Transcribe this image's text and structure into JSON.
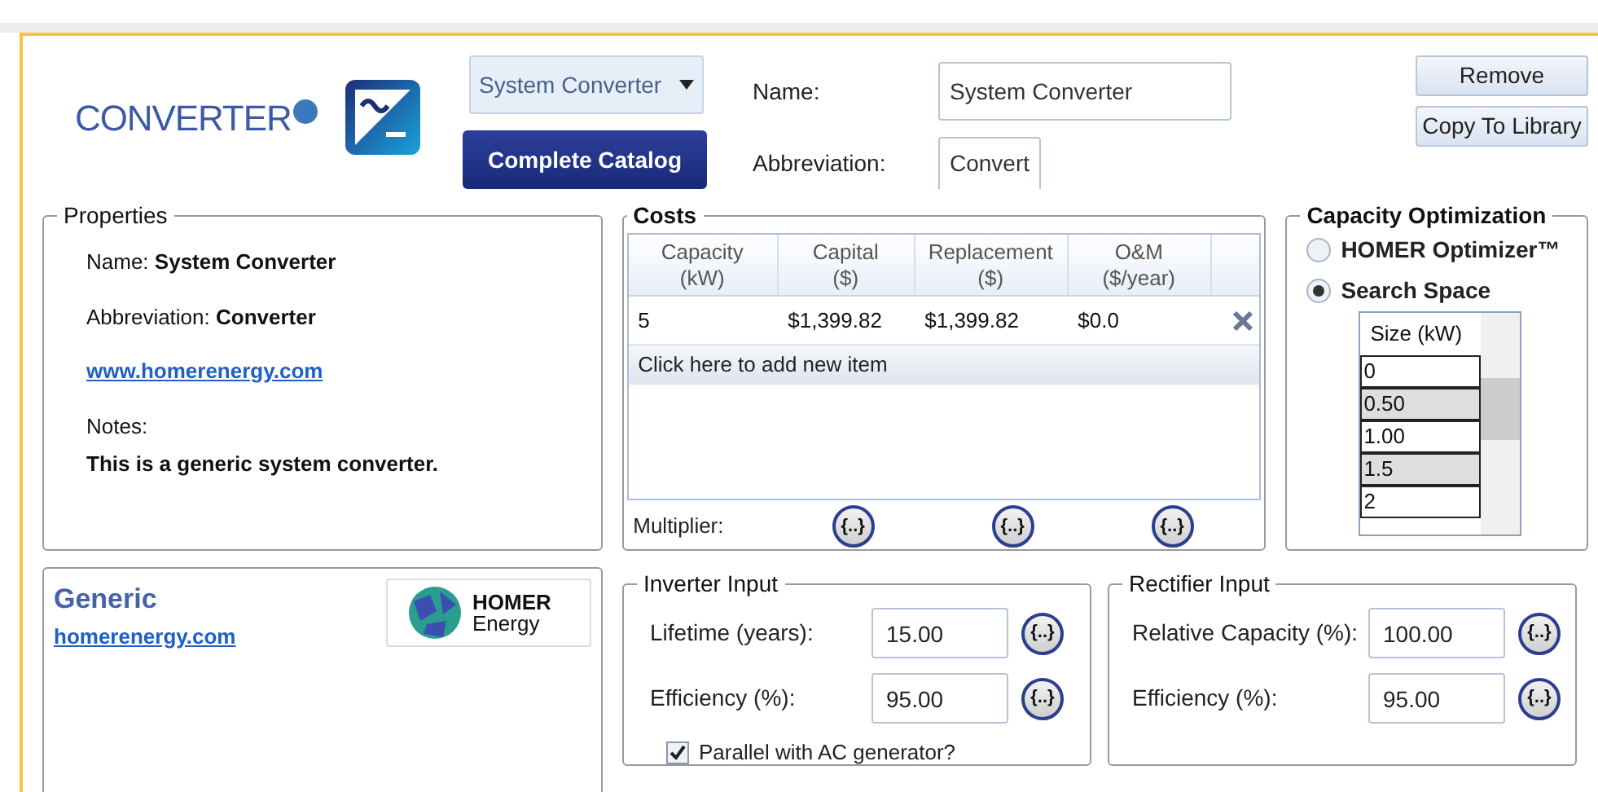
{
  "header": {
    "title": "CONVERTER",
    "type_dropdown": "System Converter",
    "catalog_button": "Complete Catalog",
    "name_label": "Name:",
    "name_value": "System Converter",
    "abbreviation_label": "Abbreviation:",
    "abbreviation_value": "Convert",
    "remove_button": "Remove",
    "copy_button": "Copy To Library"
  },
  "properties": {
    "title": "Properties",
    "name_label": "Name:",
    "name_value": "System Converter",
    "abbreviation_label": "Abbreviation:",
    "abbreviation_value": "Converter",
    "link": "www.homerenergy.com",
    "notes_label": "Notes:",
    "notes_value": "This is a generic system converter."
  },
  "costs": {
    "title": "Costs",
    "columns": [
      {
        "line1": "Capacity",
        "line2": "(kW)"
      },
      {
        "line1": "Capital",
        "line2": "($)"
      },
      {
        "line1": "Replacement",
        "line2": "($)"
      },
      {
        "line1": "O&M",
        "line2": "($/year)"
      }
    ],
    "rows": [
      {
        "cells": [
          "5",
          "$1,399.82",
          "$1,399.82",
          "$0.0"
        ]
      }
    ],
    "add_row": "Click here to add new item",
    "multiplier_label": "Multiplier:",
    "multiplier_buttons": [
      "{..}",
      "{..}",
      "{..}"
    ]
  },
  "capacity_optimization": {
    "title": "Capacity Optimization",
    "options": [
      {
        "label": "HOMER Optimizer™",
        "selected": false
      },
      {
        "label": "Search Space",
        "selected": true
      }
    ],
    "size_header": "Size (kW)",
    "sizes": [
      "0",
      "0.50",
      "1.00",
      "1.5",
      "2"
    ]
  },
  "manufacturer": {
    "name": "Generic",
    "link": "homerenergy.com",
    "logo_line1": "HOMER",
    "logo_line2": "Energy"
  },
  "inverter_input": {
    "title": "Inverter Input",
    "fields": [
      {
        "label": "Lifetime (years):",
        "value": "15.00",
        "button": "{..}"
      },
      {
        "label": "Efficiency (%):",
        "value": "95.00",
        "button": "{..}"
      }
    ],
    "parallel": {
      "label": "Parallel with AC generator?",
      "checked": true
    }
  },
  "rectifier_input": {
    "title": "Rectifier Input",
    "fields": [
      {
        "label": "Relative Capacity (%):",
        "value": "100.00",
        "button": "{..}"
      },
      {
        "label": "Efficiency (%):",
        "value": "95.00",
        "button": "{..}"
      }
    ]
  }
}
